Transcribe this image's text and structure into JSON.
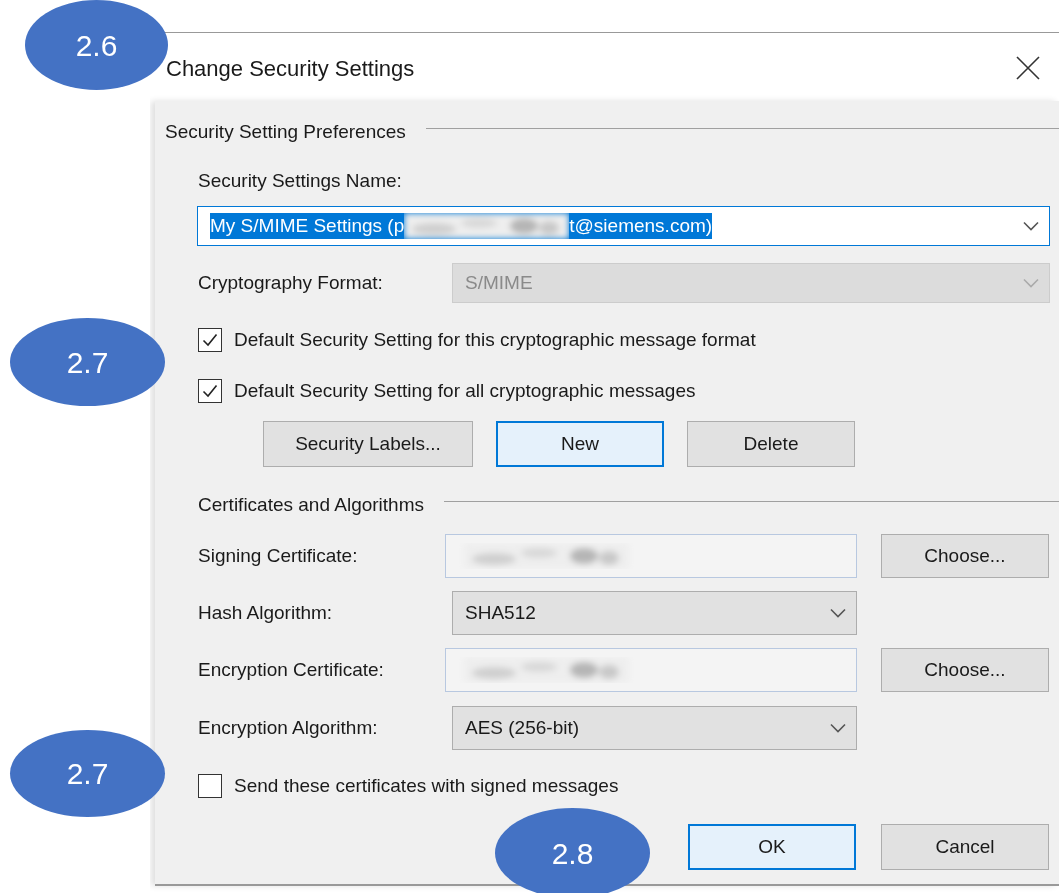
{
  "callouts": [
    {
      "label": "2.6"
    },
    {
      "label": "2.7"
    },
    {
      "label": "2.7"
    },
    {
      "label": "2.8"
    }
  ],
  "dialog": {
    "title": "Change Security Settings",
    "preferences": {
      "heading": "Security Setting Preferences",
      "name_label": "Security Settings Name:",
      "name_value_start": "My S/MIME Settings (p",
      "name_value_end": "t@siemens.com)",
      "format_label": "Cryptography Format:",
      "format_value": "S/MIME",
      "format_disabled": true,
      "checkboxes": [
        {
          "label": "Default Security Setting for this cryptographic message format",
          "checked": true
        },
        {
          "label": "Default Security Setting for all cryptographic messages",
          "checked": true
        }
      ],
      "buttons": [
        {
          "label": "Security Labels...",
          "focused": false
        },
        {
          "label": "New",
          "focused": true
        },
        {
          "label": "Delete",
          "focused": false
        }
      ]
    },
    "certificates": {
      "heading": "Certificates and Algorithms",
      "rows": [
        {
          "kind": "field",
          "label": "Signing Certificate:",
          "button": "Choose..."
        },
        {
          "kind": "dropdown",
          "label": "Hash Algorithm:",
          "value": "SHA512"
        },
        {
          "kind": "field",
          "label": "Encryption Certificate:",
          "button": "Choose..."
        },
        {
          "kind": "dropdown",
          "label": "Encryption Algorithm:",
          "value": "AES (256-bit)"
        }
      ],
      "send_checkbox": {
        "label": "Send these certificates with signed messages",
        "checked": false
      }
    },
    "footer_buttons": [
      {
        "label": "OK",
        "default": true
      },
      {
        "label": "Cancel",
        "default": false
      }
    ]
  }
}
